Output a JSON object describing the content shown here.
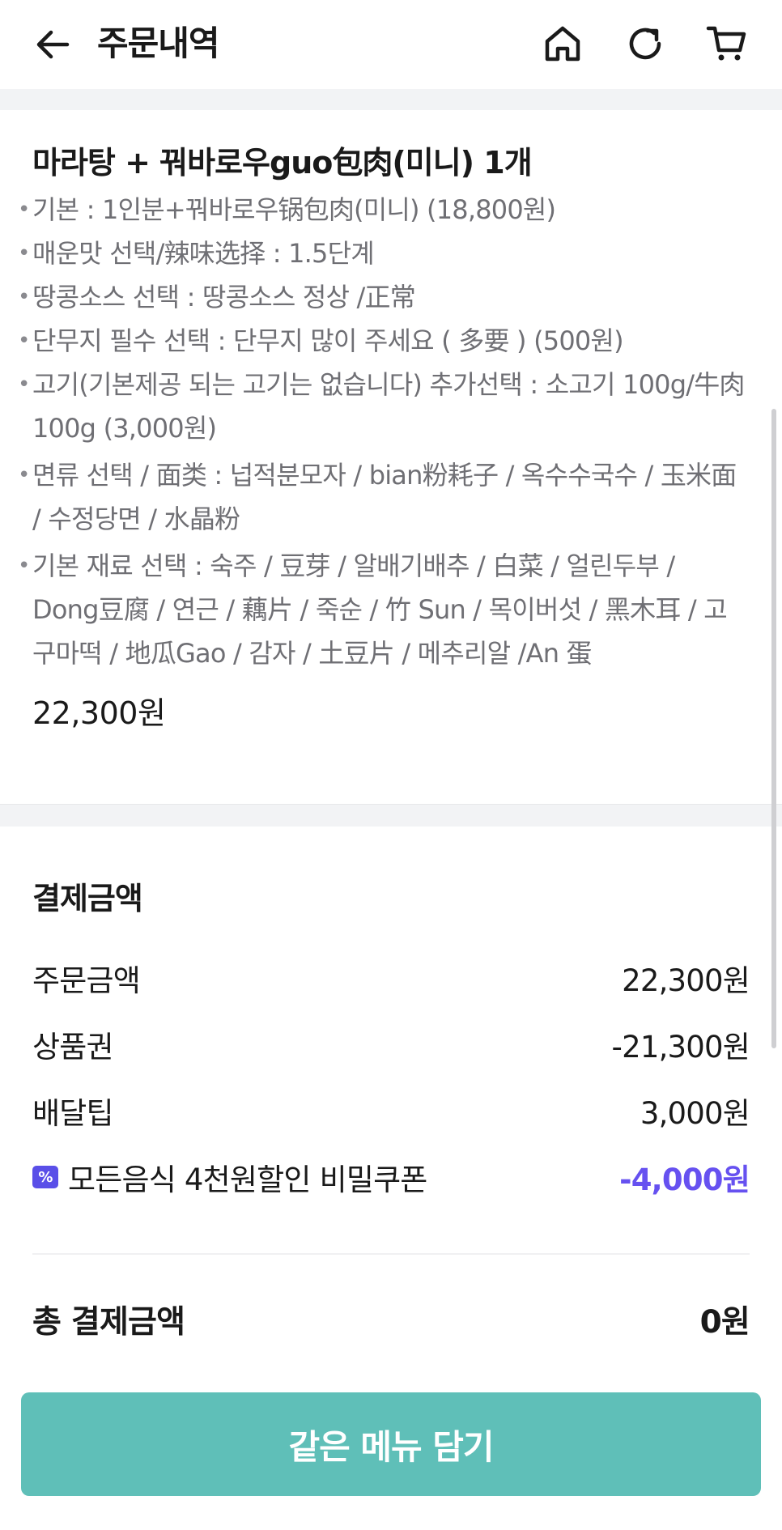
{
  "header": {
    "title": "주문내역",
    "icons": [
      "back-arrow-icon",
      "home-icon",
      "refresh-icon",
      "cart-icon"
    ]
  },
  "order": {
    "menu_title": "마라탕 + 꿔바로우guo包肉(미니) 1개",
    "options": [
      "기본 : 1인분+꿔바로우锅包肉(미니) (18,800원)",
      "매운맛 선택/辣味选择 : 1.5단계",
      "땅콩소스 선택 : 땅콩소스 정상 /正常",
      "단무지 필수 선택 : 단무지 많이 주세요 ( 多要 ) (500원)",
      "고기(기본제공 되는 고기는 없습니다) 추가선택 : 소고기 100g/牛肉100g (3,000원)",
      "면류 선택 / 面类 : 넙적분모자 / bian粉耗子 / 옥수수국수 / 玉米面 / 수정당면 / 水晶粉",
      "기본 재료 선택 : 숙주 / 豆芽 / 알배기배추 / 白菜 / 얼린두부 / Dong豆腐 / 연근 / 藕片 / 죽순 / 竹 Sun / 목이버섯 / 黑木耳 / 고구마떡 / 地瓜Gao / 감자 / 土豆片 / 메추리알 /An 蛋"
    ],
    "price": "22,300원"
  },
  "payment": {
    "title": "결제금액",
    "order_amount_label": "주문금액",
    "order_amount_value": "22,300원",
    "voucher_label": "상품권",
    "voucher_value": "-21,300원",
    "delivery_tip_label": "배달팁",
    "delivery_tip_value": "3,000원",
    "coupon_label": "모든음식 4천원할인 비밀쿠폰",
    "coupon_value": "-4,000원",
    "total_label": "총 결제금액",
    "total_value": "0원"
  },
  "cta": {
    "label": "같은 메뉴 담기"
  },
  "colors": {
    "accent_teal": "#5fbfb8",
    "coupon_purple": "#6651f0"
  }
}
